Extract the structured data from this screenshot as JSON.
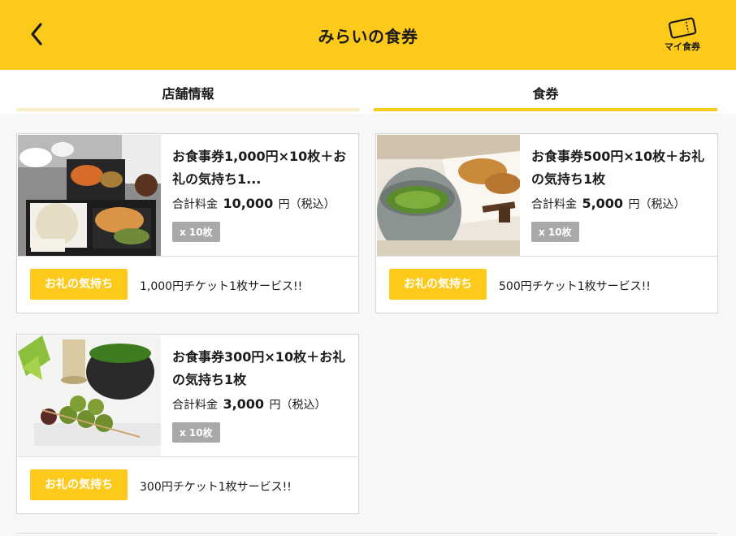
{
  "header": {
    "title": "みらいの食券",
    "my_ticket_label": "マイ食券",
    "back_icon": "chevron-left-icon",
    "ticket_icon": "ticket-icon",
    "bg_color": "#fdca1c"
  },
  "tabs": [
    {
      "label": "店舗情報",
      "active": false
    },
    {
      "label": "食券",
      "active": true
    }
  ],
  "cards": [
    {
      "title": "お食事券1,000円×10枚＋お礼の気持ち1...",
      "price_label": "合計料金",
      "price_amount": "10,000",
      "price_unit": "円（税込）",
      "quantity": "x 10枚",
      "gift_label": "お礼の気持ち",
      "service": "1,000円チケット1枚サービス!!",
      "image": "bento-meal-photo"
    },
    {
      "title": "お食事券500円×10枚＋お礼の気持ち1枚",
      "price_label": "合計料金",
      "price_amount": "5,000",
      "price_unit": "円（税込）",
      "quantity": "x 10枚",
      "gift_label": "お礼の気持ち",
      "service": "500円チケット1枚サービス!!",
      "image": "matcha-taiyaki-photo"
    },
    {
      "title": "お食事券300円×10枚＋お礼の気持ち1枚",
      "price_label": "合計料金",
      "price_amount": "3,000",
      "price_unit": "円（税込）",
      "quantity": "x 10枚",
      "gift_label": "お礼の気持ち",
      "service": "300円チケット1枚サービス!!",
      "image": "matcha-dango-photo"
    }
  ]
}
